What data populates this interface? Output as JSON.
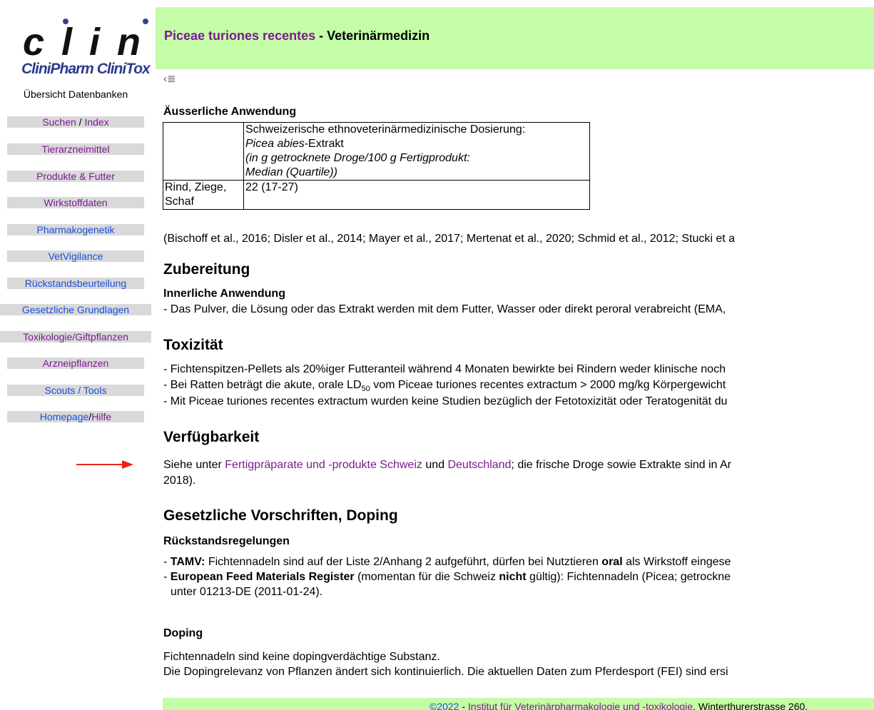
{
  "logo": {
    "wordmark": "clini",
    "brand": "CliniPharm CliniTox"
  },
  "sidebar": {
    "overview": "Übersicht Datenbanken",
    "items": [
      {
        "label": "Suchen",
        "label2": "Index"
      },
      {
        "label": "Tierarzneimittel"
      },
      {
        "label": "Produkte & Futter"
      },
      {
        "label": "Wirkstoffdaten"
      },
      {
        "label": "Pharmakogenetik"
      },
      {
        "label": "VetVigilance"
      },
      {
        "label": "Rückstandsbeurteilung"
      },
      {
        "label": "Gesetzliche Grundlagen"
      },
      {
        "label": "Toxikologie/Giftpflanzen"
      },
      {
        "label": "Arzneipflanzen"
      },
      {
        "label": "Scouts / Tools"
      },
      {
        "label": "Homepage",
        "label2": "Hilfe"
      }
    ]
  },
  "header": {
    "plant": "Piceae turiones recentes",
    "suffix": " - Veterinärmedizin"
  },
  "back_icon": "‹≣",
  "section_external": {
    "heading": "Äusserliche Anwendung",
    "table": {
      "header_line1": "Schweizerische ethnoveterinärmedizinische Dosierung:",
      "header_line2_italic": "Picea abies",
      "header_line2_rest": "-Extrakt",
      "header_line3": "(in g getrocknete Droge/100 g Fertigprodukt:",
      "header_line4": "Median (Quartile))",
      "row_species_1": "Rind, Ziege,",
      "row_species_2": "Schaf",
      "row_value": "22 (17-27)"
    },
    "citation": "(Bischoff et al., 2016; Disler et al., 2014; Mayer et al., 2017; Mertenat et al., 2020; Schmid et al., 2012; Stucki et a"
  },
  "zubereitung": {
    "heading": "Zubereitung",
    "sub": "Innerliche Anwendung",
    "text": "- Das Pulver, die Lösung oder das Extrakt werden mit dem Futter, Wasser oder direkt peroral verabreicht (EMA,"
  },
  "toxizitaet": {
    "heading": "Toxizität",
    "line1": "- Fichtenspitzen-Pellets als 20%iger Futteranteil während 4 Monaten bewirkte bei Rindern weder klinische noch",
    "line2_a": "- Bei Ratten beträgt die akute, orale LD",
    "line2_sub": "50",
    "line2_b": " vom Piceae turiones recentes extractum > 2000 mg/kg Körpergewicht",
    "line3": "- Mit Piceae turiones recentes extractum wurden keine Studien bezüglich der Fetotoxizität oder Teratogenität du"
  },
  "verfuegbarkeit": {
    "heading": "Verfügbarkeit",
    "t1": "Siehe unter ",
    "link1": "Fertigpräparate und -produkte Schweiz",
    "t2": " und ",
    "link2": "Deutschland",
    "t3": "; die frische Droge sowie Extrakte sind in Ar",
    "line2": "2018)."
  },
  "vorschriften": {
    "heading": "Gesetzliche Vorschriften, Doping",
    "sub": "Rückstandsregelungen",
    "l1_bold": "TAMV:",
    "l1_a": " Fichtennadeln sind auf der Liste 2/Anhang 2 aufgeführt, dürfen bei Nutztieren ",
    "l1_bold2": "oral",
    "l1_b": " als Wirkstoff eingese",
    "l2_bold": "European Feed Materials Register",
    "l2_a": " (momentan für die Schweiz ",
    "l2_bold2": "nicht",
    "l2_b": " gültig): Fichtennadeln (Picea; getrockne",
    "l3": "unter 01213-DE (2011-01-24).",
    "dash": "- "
  },
  "doping": {
    "heading": "Doping",
    "line1": "Fichtennadeln sind keine dopingverdächtige Substanz.",
    "line2": "Die Dopingrelevanz von Pflanzen ändert sich kontinuierlich. Die aktuellen Daten zum Pferdesport (FEI) sind ersi"
  },
  "footer": {
    "copyright": "©2022",
    "sep": " - ",
    "institute": "Institut für Veterinärpharmakologie und -toxikologie",
    "address": ", Winterthurerstrasse 260,"
  },
  "colors": {
    "header_bg": "#c5fca8",
    "link_purple": "#7b1b8f",
    "link_blue": "#1a4fd8",
    "nav_bg": "#d9d9d9",
    "arrow": "#e8231c"
  }
}
